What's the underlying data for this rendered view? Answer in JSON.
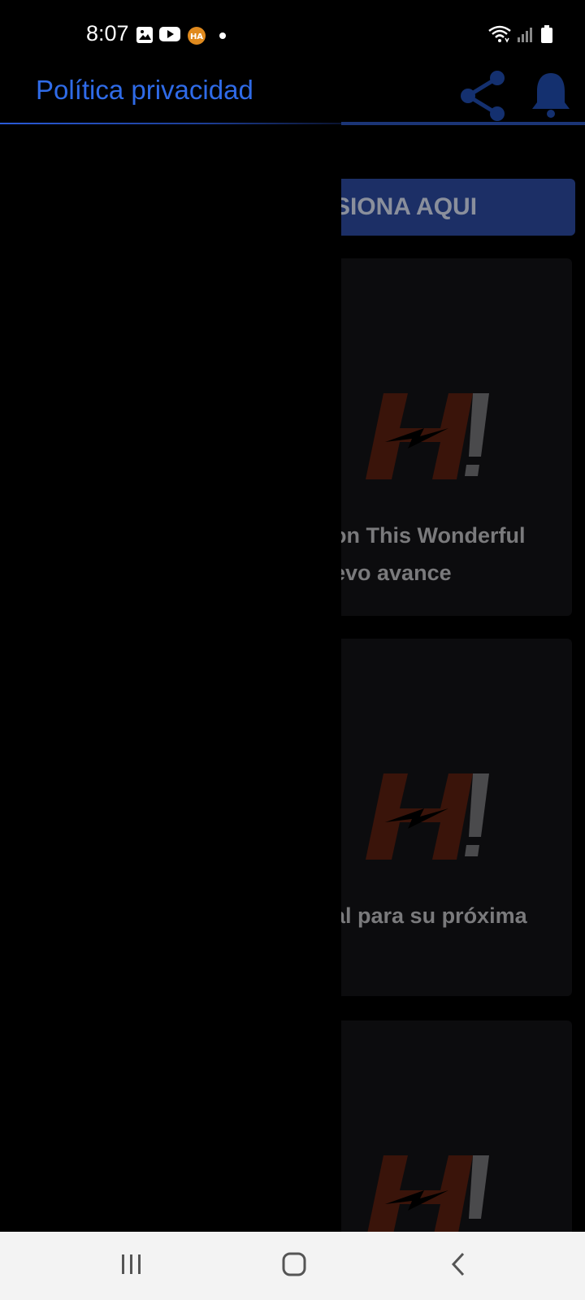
{
  "status_bar": {
    "time": "8:07",
    "icons": [
      "gallery-icon",
      "youtube-icon",
      "app-notification-icon",
      "dot-icon",
      "wifi-icon",
      "signal-icon",
      "battery-icon"
    ]
  },
  "drawer": {
    "title": "Política privacidad",
    "accent_color": "#2f6be8"
  },
  "app": {
    "cta_label": "SIONA AQUI",
    "cards": [
      {
        "title": "on This Wonderful evo avance"
      },
      {
        "title": "al para su próxima"
      },
      {
        "title": ""
      }
    ]
  },
  "nav_bar": {
    "buttons": [
      "recents-button",
      "home-button",
      "back-button"
    ]
  },
  "colors": {
    "background": "#000000",
    "cta_background": "#1c2f66",
    "card_background": "#0c0c0e",
    "logo_red": "#8a2a10"
  }
}
